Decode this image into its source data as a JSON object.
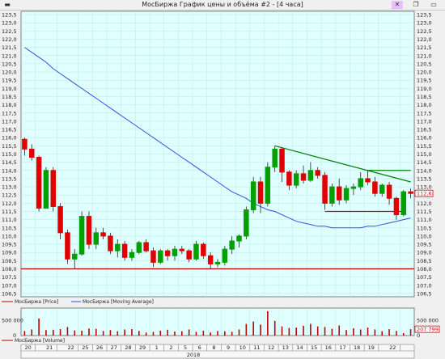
{
  "window": {
    "title": "МосБиржа График цены и объёма #2 - [4 часа]",
    "close_symbol": "✕",
    "restore_symbol": "❐",
    "minimize_symbol": "▭",
    "app_icon_symbol": "▬"
  },
  "colors": {
    "background": "#e0ffff",
    "bull": "#00a000",
    "bear": "#e00000",
    "ma": "#3050e0",
    "support": "#c00000",
    "trend_down": "#008000"
  },
  "price_panel": {
    "y_ticks": [
      "123,5",
      "123,0",
      "122,5",
      "122,0",
      "121,5",
      "121,0",
      "120,5",
      "120,0",
      "119,5",
      "119,0",
      "118,5",
      "118,0",
      "117,5",
      "117,0",
      "116,5",
      "116,0",
      "115,5",
      "115,0",
      "114,5",
      "114,0",
      "113,5",
      "113,0",
      "112,5",
      "112,0",
      "111,5",
      "111,0",
      "110,5",
      "110,0",
      "109,5",
      "109,0",
      "108,5",
      "108,0",
      "107,5",
      "107,0",
      "106,5"
    ],
    "last_price_label": "112,6",
    "legend": [
      {
        "label": "МосБиржа [Price]",
        "color": "#c00000"
      },
      {
        "label": "МосБиржа [Moving Average]",
        "color": "#3050e0"
      }
    ]
  },
  "volume_panel": {
    "y_ticks": [
      "500 000",
      "0"
    ],
    "last_volume_label": "207 799",
    "legend": [
      {
        "label": "МосБиржа [Volume]",
        "color": "#c00000"
      }
    ]
  },
  "x_axis": {
    "day_labels": [
      "20",
      "21",
      "22",
      "25",
      "26",
      "27",
      "28",
      "29",
      "1",
      "2",
      "5",
      "6",
      "8",
      "9",
      "10",
      "11",
      "12",
      "13",
      "14",
      "15",
      "16",
      "17",
      "18",
      "19",
      "22"
    ],
    "year_label": "2018"
  },
  "chart_data": {
    "type": "candlestick",
    "series": [
      {
        "name": "МосБиржа [Price]",
        "ohlc": [
          [
            115.9,
            116.0,
            114.9,
            115.3
          ],
          [
            115.3,
            115.6,
            114.6,
            114.8
          ],
          [
            114.8,
            114.9,
            111.5,
            111.7
          ],
          [
            111.7,
            114.2,
            111.7,
            114.0
          ],
          [
            114.0,
            114.2,
            111.5,
            111.8
          ],
          [
            111.8,
            112.0,
            109.8,
            110.2
          ],
          [
            110.2,
            110.4,
            108.3,
            108.6
          ],
          [
            108.6,
            109.2,
            108.0,
            108.9
          ],
          [
            108.9,
            111.5,
            108.8,
            111.2
          ],
          [
            111.2,
            111.5,
            109.2,
            109.5
          ],
          [
            109.5,
            110.5,
            109.2,
            110.2
          ],
          [
            110.2,
            110.5,
            109.8,
            110.0
          ],
          [
            110.0,
            110.2,
            108.9,
            109.1
          ],
          [
            109.1,
            109.8,
            108.7,
            109.5
          ],
          [
            109.5,
            109.7,
            108.5,
            108.7
          ],
          [
            108.7,
            109.2,
            108.5,
            109.0
          ],
          [
            109.0,
            109.7,
            108.9,
            109.6
          ],
          [
            109.6,
            109.8,
            109.0,
            109.1
          ],
          [
            109.1,
            109.3,
            108.1,
            108.4
          ],
          [
            108.4,
            109.2,
            108.3,
            109.1
          ],
          [
            109.1,
            109.2,
            108.5,
            108.8
          ],
          [
            108.8,
            109.4,
            108.5,
            109.2
          ],
          [
            109.2,
            109.4,
            108.9,
            109.1
          ],
          [
            109.1,
            109.2,
            108.4,
            108.6
          ],
          [
            108.6,
            109.7,
            108.5,
            109.5
          ],
          [
            109.5,
            109.6,
            108.6,
            108.8
          ],
          [
            108.8,
            109.0,
            108.0,
            108.3
          ],
          [
            108.3,
            108.6,
            108.1,
            108.4
          ],
          [
            108.4,
            109.4,
            108.2,
            109.2
          ],
          [
            109.2,
            110.0,
            108.9,
            109.7
          ],
          [
            109.7,
            110.1,
            109.3,
            110.0
          ],
          [
            110.0,
            111.8,
            109.8,
            111.6
          ],
          [
            111.6,
            113.6,
            111.4,
            113.3
          ],
          [
            113.3,
            113.6,
            111.4,
            112.0
          ],
          [
            112.0,
            114.5,
            111.8,
            114.2
          ],
          [
            114.2,
            115.5,
            113.9,
            115.3
          ],
          [
            115.3,
            115.4,
            113.3,
            113.9
          ],
          [
            113.9,
            114.0,
            112.8,
            113.1
          ],
          [
            113.1,
            114.0,
            112.9,
            113.8
          ],
          [
            113.8,
            114.3,
            113.2,
            113.4
          ],
          [
            113.4,
            114.5,
            113.3,
            114.0
          ],
          [
            114.0,
            114.2,
            113.5,
            113.7
          ],
          [
            113.7,
            113.9,
            111.6,
            112.0
          ],
          [
            112.0,
            113.2,
            111.8,
            113.0
          ],
          [
            113.0,
            113.5,
            111.9,
            112.2
          ],
          [
            112.2,
            113.1,
            112.0,
            112.9
          ],
          [
            112.9,
            113.2,
            112.5,
            113.0
          ],
          [
            113.0,
            113.9,
            112.8,
            113.5
          ],
          [
            113.5,
            114.0,
            113.1,
            113.3
          ],
          [
            113.3,
            113.6,
            112.4,
            112.6
          ],
          [
            112.6,
            113.2,
            112.4,
            113.1
          ],
          [
            113.1,
            113.3,
            111.9,
            112.3
          ],
          [
            112.3,
            112.4,
            111.0,
            111.3
          ],
          [
            111.3,
            112.8,
            111.2,
            112.7
          ],
          [
            112.7,
            112.9,
            112.3,
            112.6
          ]
        ],
        "volume": [
          150000,
          200000,
          560000,
          180000,
          190000,
          210000,
          280000,
          170000,
          160000,
          230000,
          220000,
          150000,
          180000,
          140000,
          200000,
          210000,
          150000,
          100000,
          120000,
          160000,
          190000,
          130000,
          140000,
          200000,
          120000,
          160000,
          100000,
          150000,
          140000,
          120000,
          200000,
          380000,
          460000,
          360000,
          800000,
          480000,
          300000,
          250000,
          260000,
          320000,
          380000,
          300000,
          280000,
          220000,
          330000,
          180000,
          240000,
          200000,
          260000,
          200000,
          140000,
          210000,
          150000,
          80000,
          207799
        ]
      },
      {
        "name": "МосБиржа [Moving Average]",
        "values": [
          121.5,
          121.2,
          120.9,
          120.6,
          120.2,
          119.9,
          119.6,
          119.3,
          119.0,
          118.7,
          118.4,
          118.1,
          117.8,
          117.5,
          117.2,
          116.9,
          116.6,
          116.3,
          116.0,
          115.7,
          115.4,
          115.1,
          114.8,
          114.5,
          114.2,
          113.9,
          113.6,
          113.3,
          113.0,
          112.7,
          112.5,
          112.3,
          112.0,
          111.8,
          111.6,
          111.5,
          111.3,
          111.1,
          110.9,
          110.8,
          110.7,
          110.6,
          110.6,
          110.5,
          110.5,
          110.5,
          110.5,
          110.5,
          110.6,
          110.6,
          110.7,
          110.8,
          110.9,
          111.0,
          111.1
        ]
      }
    ],
    "annotations": [
      {
        "type": "horizontal",
        "value": 108.0,
        "color": "#c00000"
      },
      {
        "type": "trendline",
        "from": [
          35,
          115.5
        ],
        "to": [
          54,
          113.3
        ],
        "color": "#008000"
      },
      {
        "type": "segment",
        "from": [
          48,
          114.0
        ],
        "to": [
          54,
          114.0
        ],
        "color": "#008000"
      },
      {
        "type": "segment",
        "from": [
          42,
          111.5
        ],
        "to": [
          53,
          111.5
        ],
        "color": "#c00000"
      }
    ],
    "ylim": [
      106.3,
      123.7
    ],
    "volume_ylim": [
      0,
      900000
    ]
  }
}
